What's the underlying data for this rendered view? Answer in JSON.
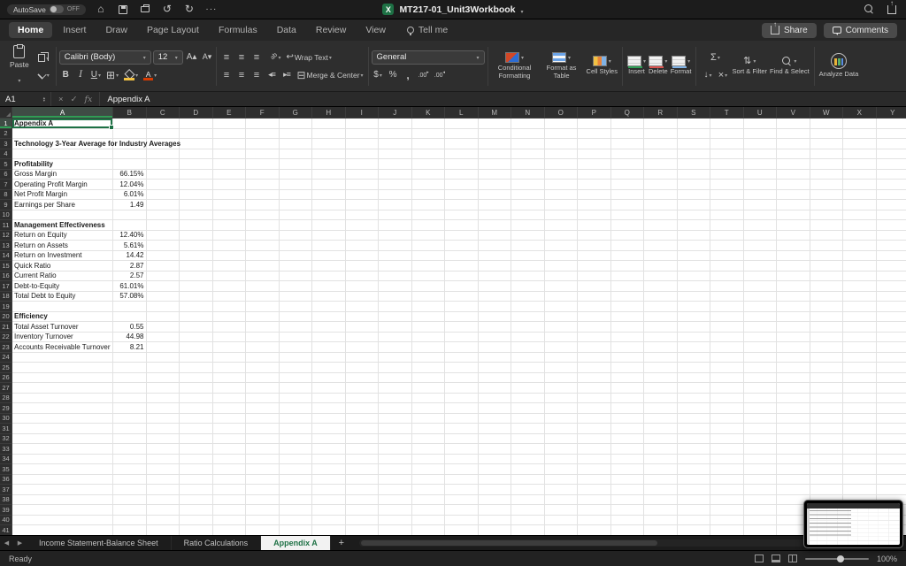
{
  "theme": {
    "excel_green": "#1e7145"
  },
  "titlebar": {
    "autosave_label": "AutoSave",
    "autosave_state": "OFF",
    "doc_title": "MT217-01_Unit3Workbook"
  },
  "ribbon": {
    "tabs": [
      {
        "label": "Home",
        "active": true
      },
      {
        "label": "Insert"
      },
      {
        "label": "Draw"
      },
      {
        "label": "Page Layout"
      },
      {
        "label": "Formulas"
      },
      {
        "label": "Data"
      },
      {
        "label": "Review"
      },
      {
        "label": "View"
      }
    ],
    "tell_me": "Tell me",
    "share_label": "Share",
    "comments_label": "Comments",
    "clipboard": {
      "paste": "Paste"
    },
    "font": {
      "name": "Calibri (Body)",
      "size": "12"
    },
    "alignment": {
      "wrap_text": "Wrap Text",
      "merge_center": "Merge & Center"
    },
    "number": {
      "format": "General"
    },
    "styles": {
      "conditional_formatting": "Conditional Formatting",
      "format_as_table": "Format as Table",
      "cell_styles": "Cell Styles"
    },
    "cells": {
      "insert": "Insert",
      "delete": "Delete",
      "format": "Format"
    },
    "editing": {
      "sort_filter": "Sort & Filter",
      "find_select": "Find & Select"
    },
    "analyze": {
      "label": "Analyze Data"
    }
  },
  "formula_bar": {
    "cell_ref": "A1",
    "content": "Appendix A"
  },
  "sheet": {
    "columns": [
      "A",
      "B",
      "C",
      "D",
      "E",
      "F",
      "G",
      "H",
      "I",
      "J",
      "K",
      "L",
      "M",
      "N",
      "O",
      "P",
      "Q",
      "R",
      "S",
      "T",
      "U",
      "V",
      "W",
      "X",
      "Y"
    ],
    "row_count": 41,
    "selected_cell": "A1",
    "rows": [
      {
        "n": 1,
        "A": "Appendix A",
        "bold": true
      },
      {
        "n": 3,
        "A": "Technology  3-Year Average for Industry Averages",
        "bold": true
      },
      {
        "n": 5,
        "A": "Profitability",
        "bold": true
      },
      {
        "n": 6,
        "A": "Gross Margin",
        "B": "66.15%"
      },
      {
        "n": 7,
        "A": "Operating Profit Margin",
        "B": "12.04%"
      },
      {
        "n": 8,
        "A": "Net Profit Margin",
        "B": "6.01%"
      },
      {
        "n": 9,
        "A": "Earnings per Share",
        "B": "1.49"
      },
      {
        "n": 11,
        "A": "Management Effectiveness",
        "bold": true
      },
      {
        "n": 12,
        "A": "Return on Equity",
        "B": "12.40%"
      },
      {
        "n": 13,
        "A": "Return on Assets",
        "B": "5.61%"
      },
      {
        "n": 14,
        "A": "Return on Investment",
        "B": "14.42"
      },
      {
        "n": 15,
        "A": "Quick Ratio",
        "B": "2.87"
      },
      {
        "n": 16,
        "A": "Current Ratio",
        "B": "2.57"
      },
      {
        "n": 17,
        "A": "Debt-to-Equity",
        "B": "61.01%"
      },
      {
        "n": 18,
        "A": "Total Debt to Equity",
        "B": "57.08%"
      },
      {
        "n": 20,
        "A": "Efficiency",
        "bold": true
      },
      {
        "n": 21,
        "A": "Total Asset Turnover",
        "B": "0.55"
      },
      {
        "n": 22,
        "A": "Inventory Turnover",
        "B": "44.98"
      },
      {
        "n": 23,
        "A": "Accounts Receivable Turnover",
        "B": "8.21"
      }
    ]
  },
  "sheet_tabs": {
    "items": [
      {
        "label": "Income Statement-Balance Sheet",
        "active": false
      },
      {
        "label": "Ratio Calculations",
        "active": false
      },
      {
        "label": "Appendix A",
        "active": true
      }
    ]
  },
  "status": {
    "mode": "Ready",
    "zoom": "100%"
  }
}
